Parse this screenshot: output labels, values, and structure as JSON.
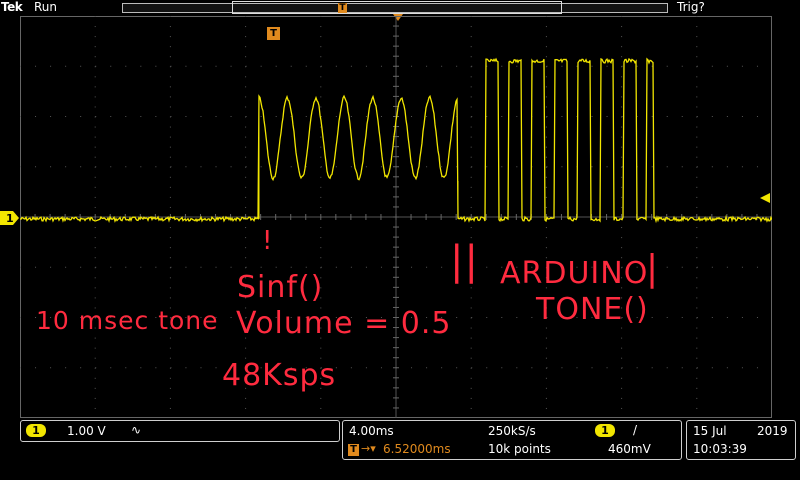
{
  "header": {
    "brand": "Tek",
    "run_state": "Run",
    "trigger_status": "Trig?",
    "record_trigger_label": "T"
  },
  "display": {
    "trigger_marker_label": "T",
    "channel_marker_label": "1",
    "trace_color": "#f2e600"
  },
  "annotations": {
    "tone_label": "10 msec tone",
    "sinf_mark": "!",
    "sinf_label": "Sinf()",
    "volume_label": "Volume = 0.5",
    "rate_label": "48Ksps",
    "arduino_bracket": "||",
    "arduino_label": "ARDUINO",
    "arduino_label_2": "TONE()",
    "arduino_end": "|",
    "annotation_color": "#ff2b3f"
  },
  "channel_panel": {
    "channel": "1",
    "scale": "1.00 V",
    "bandwidth_icon": "∿"
  },
  "timebase_panel": {
    "time_per_div": "4.00ms",
    "sample_rate": "250kS/s",
    "trigger_channel": "1",
    "trigger_slope": "/",
    "trigger_label": "T",
    "position_arrow": "→▾",
    "position": "6.52000ms",
    "record_length": "10k points",
    "trigger_level": "460mV"
  },
  "datetime_panel": {
    "date": "15 Jul",
    "year": "2019",
    "time": "10:03:39"
  }
}
